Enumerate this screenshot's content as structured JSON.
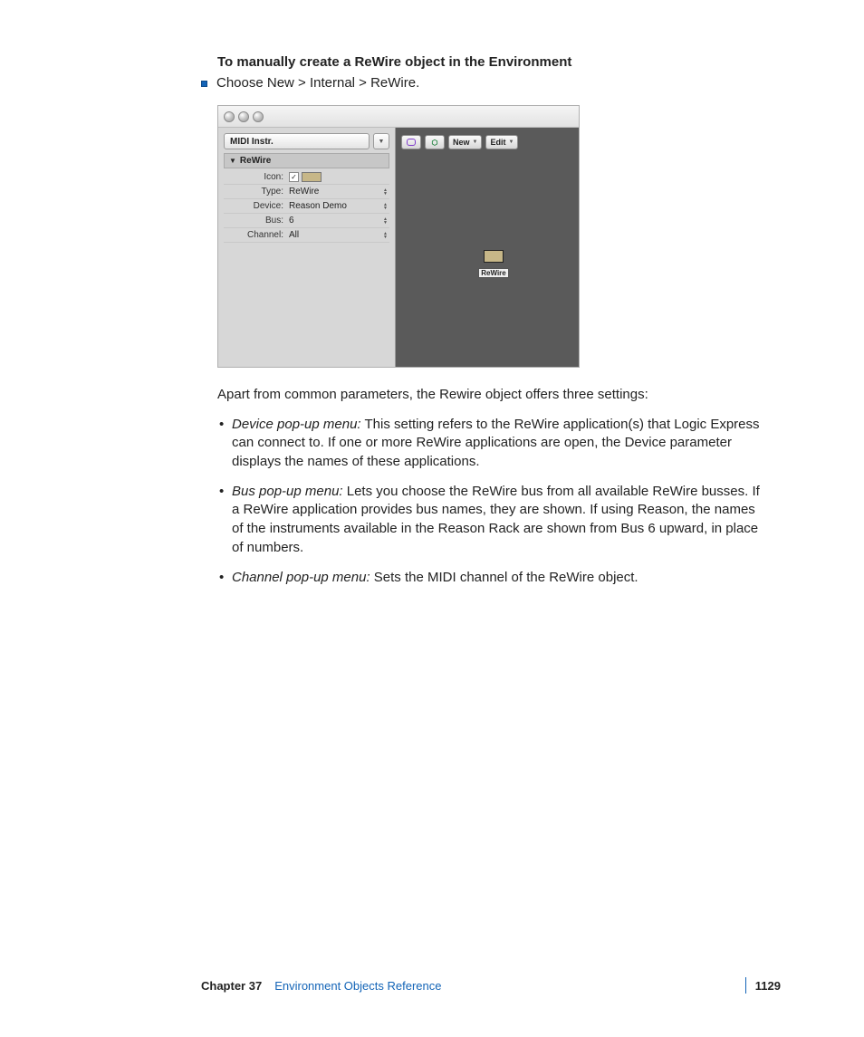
{
  "heading": "To manually create a ReWire object in the Environment",
  "step": "Choose New > Internal > ReWire.",
  "screenshot": {
    "inspector_title": "MIDI Instr.",
    "section_title": "ReWire",
    "rows": {
      "icon_label": "Icon:",
      "type_label": "Type:",
      "type_value": "ReWire",
      "device_label": "Device:",
      "device_value": "Reason Demo",
      "bus_label": "Bus:",
      "bus_value": "6",
      "channel_label": "Channel:",
      "channel_value": "All"
    },
    "toolbar": {
      "new": "New",
      "edit": "Edit"
    },
    "canvas_object_label": "ReWire"
  },
  "intro_paragraph": "Apart from common parameters, the Rewire object offers three settings:",
  "items": [
    {
      "term": "Device pop-up menu:",
      "body": "This setting refers to the ReWire application(s) that Logic Express can connect to. If one or more ReWire applications are open, the Device parameter displays the names of these applications."
    },
    {
      "term": "Bus pop-up menu:",
      "body": "Lets you choose the ReWire bus from all available ReWire busses. If a ReWire application provides bus names, they are shown. If using Reason, the names of the instruments available in the Reason Rack are shown from Bus 6 upward, in place of numbers."
    },
    {
      "term": "Channel pop-up menu:",
      "body": "Sets the MIDI channel of the ReWire object."
    }
  ],
  "footer": {
    "chapter_label": "Chapter 37",
    "chapter_title": "Environment Objects Reference",
    "page_number": "1129"
  }
}
